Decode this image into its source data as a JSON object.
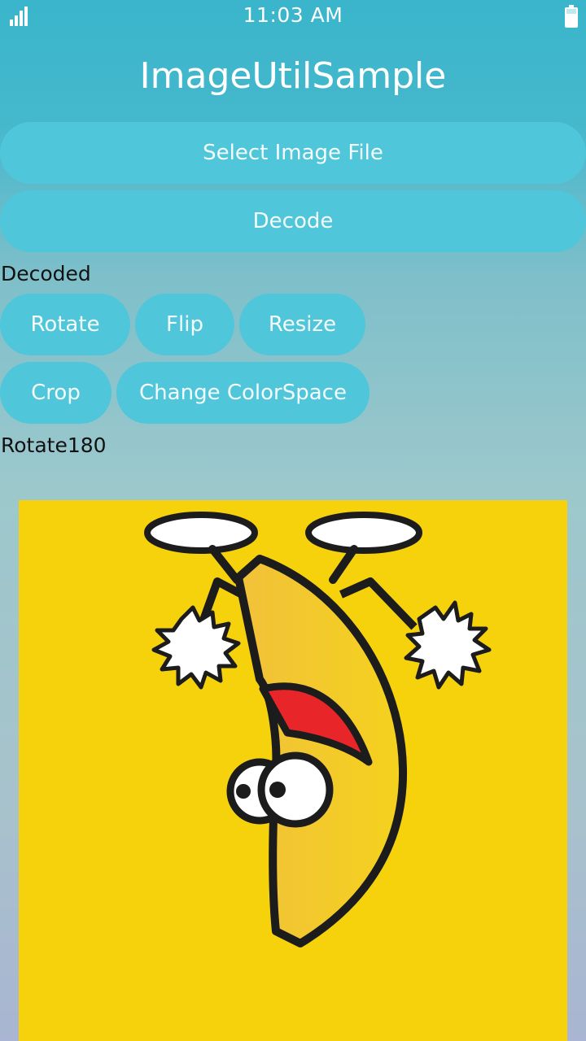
{
  "status_bar": {
    "time": "11:03 AM",
    "signal_icon": "signal-bars-icon",
    "battery_icon": "battery-icon"
  },
  "app": {
    "title": "ImageUtilSample"
  },
  "buttons": {
    "select_image_file": "Select Image File",
    "decode": "Decode",
    "rotate": "Rotate",
    "flip": "Flip",
    "resize": "Resize",
    "crop": "Crop",
    "change_colorspace": "Change ColorSpace"
  },
  "status": {
    "decode_state": "Decoded",
    "operation": "Rotate180"
  },
  "image": {
    "description_icon": "banana-cartoon-image",
    "background_color": "#f6d20c"
  },
  "colors": {
    "button_bg": "#4fc6d9",
    "header_bg": "#3ab5cb"
  }
}
